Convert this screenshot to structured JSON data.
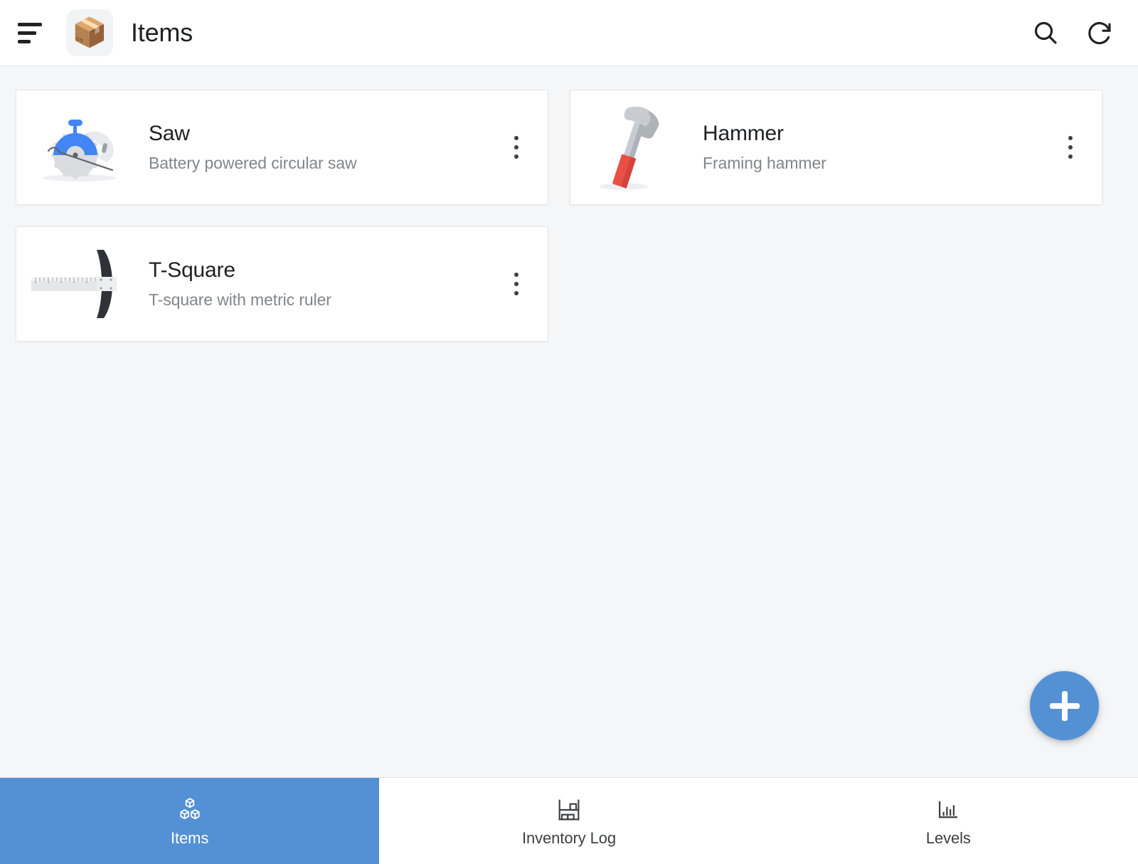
{
  "appbar": {
    "menu_icon": "hamburger-menu-icon",
    "app_emoji": "📦",
    "title": "Items",
    "search_icon": "search-icon",
    "refresh_icon": "refresh-icon"
  },
  "colors": {
    "accent": "#5490d4",
    "page_background": "#f4f6f8",
    "card_background": "#ffffff",
    "card_border": "#e3e5e8",
    "primary_text": "#202124",
    "secondary_text": "#80868b"
  },
  "items": [
    {
      "name": "Saw",
      "description": "Battery powered circular saw",
      "thumb_icon": "circular-saw-icon",
      "menu_icon": "more-options-icon"
    },
    {
      "name": "Hammer",
      "description": "Framing hammer",
      "thumb_icon": "hammer-icon",
      "menu_icon": "more-options-icon"
    },
    {
      "name": "T-Square",
      "description": "T-square with metric ruler",
      "thumb_icon": "t-square-ruler-icon",
      "menu_icon": "more-options-icon"
    }
  ],
  "fab": {
    "label": "+",
    "icon": "plus-icon"
  },
  "bottomnav": {
    "tabs": [
      {
        "label": "Items",
        "icon": "boxes-icon",
        "active": true
      },
      {
        "label": "Inventory Log",
        "icon": "warehouse-shelf-icon",
        "active": false
      },
      {
        "label": "Levels",
        "icon": "bar-chart-icon",
        "active": false
      }
    ]
  }
}
